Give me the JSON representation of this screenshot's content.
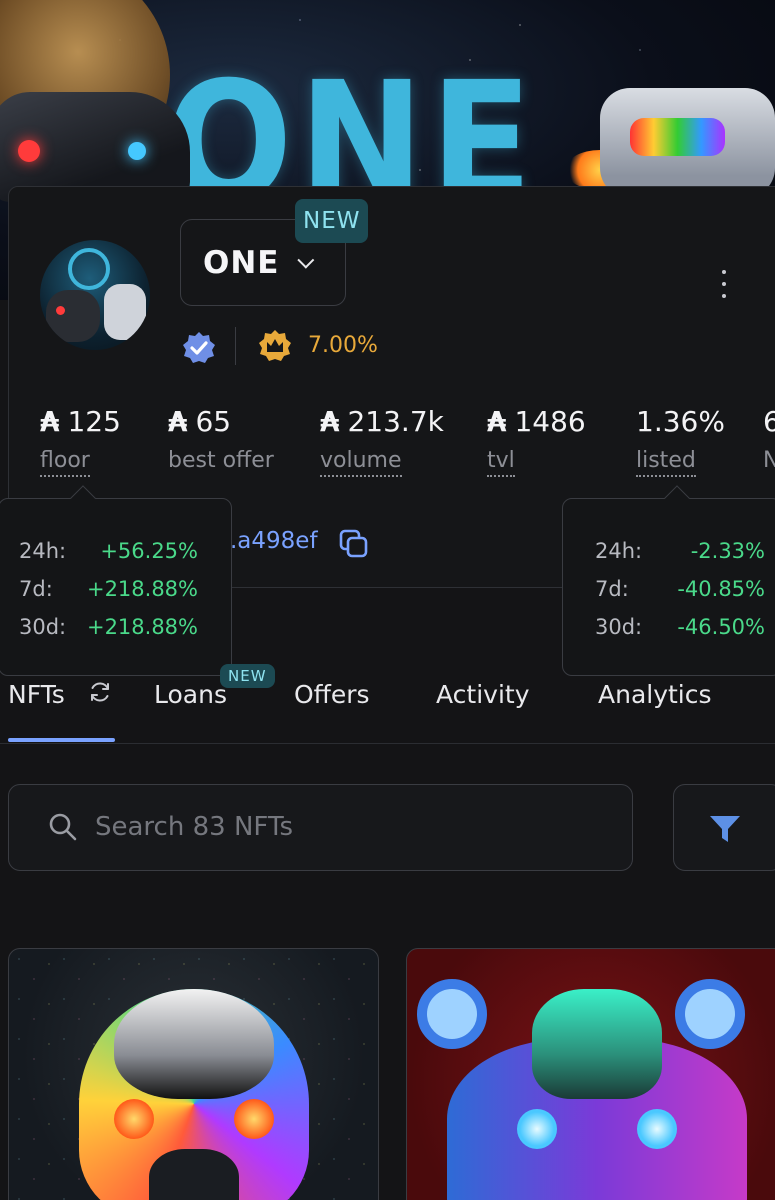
{
  "banner": {
    "logo_text": "ONE"
  },
  "collection": {
    "name": "ONE",
    "new_badge": "NEW",
    "royalty": "7.00%",
    "address_short": ".a498ef"
  },
  "stats": [
    {
      "value": "125",
      "label": "floor",
      "currency": "₳"
    },
    {
      "value": "65",
      "label": "best offer",
      "currency": "₳"
    },
    {
      "value": "213.7k",
      "label": "volume",
      "currency": "₳"
    },
    {
      "value": "1486",
      "label": "tvl",
      "currency": "₳"
    },
    {
      "value": "1.36%",
      "label": "listed"
    },
    {
      "value": "6",
      "label": "N"
    }
  ],
  "tooltip_floor": [
    {
      "period": "24h:",
      "change": "+56.25%"
    },
    {
      "period": "7d:",
      "change": "+218.88%"
    },
    {
      "period": "30d:",
      "change": "+218.88%"
    }
  ],
  "tooltip_listed": [
    {
      "period": "24h:",
      "change": "-2.33%"
    },
    {
      "period": "7d:",
      "change": "-40.85%"
    },
    {
      "period": "30d:",
      "change": "-46.50%"
    }
  ],
  "tabs": [
    {
      "label": "NFTs",
      "active": true
    },
    {
      "label": "Loans",
      "badge": "NEW"
    },
    {
      "label": "Offers"
    },
    {
      "label": "Activity"
    },
    {
      "label": "Analytics"
    }
  ],
  "search": {
    "placeholder": "Search 83 NFTs"
  },
  "colors": {
    "accent": "#7aa2ff",
    "positive": "#4ad98a",
    "royalty": "#e8a93a",
    "badge_bg": "#1c4a53",
    "badge_text": "#8fe3f0"
  },
  "icons": [
    "verified-badge-icon",
    "crown-icon",
    "kebab-menu-icon",
    "chevron-down-icon",
    "copy-icon",
    "refresh-icon",
    "search-icon",
    "filter-icon"
  ]
}
